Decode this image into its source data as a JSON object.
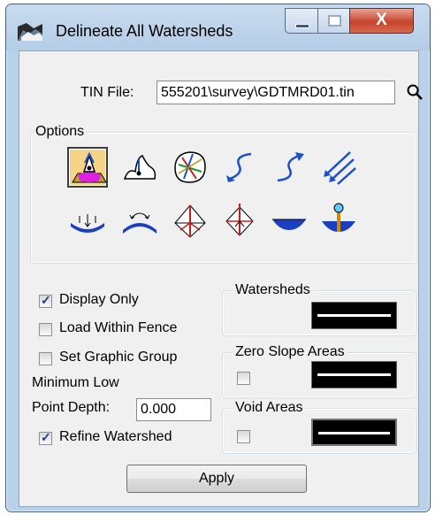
{
  "window": {
    "title": "Delineate All Watersheds",
    "close_glyph": "X"
  },
  "tin": {
    "label": "TIN File:",
    "value": "555201\\survey\\GDTMRD01.tin",
    "search_icon": "magnifier-icon"
  },
  "options": {
    "title": "Options",
    "icons": [
      {
        "name": "delineate-watershed-icon",
        "selected": true
      },
      {
        "name": "single-watershed-icon",
        "selected": false
      },
      {
        "name": "colored-watersheds-icon",
        "selected": false
      },
      {
        "name": "flow-path-icon",
        "selected": false
      },
      {
        "name": "reverse-flow-path-icon",
        "selected": false
      },
      {
        "name": "flow-arrows-icon",
        "selected": false
      },
      {
        "name": "low-point-icon",
        "selected": false
      },
      {
        "name": "high-point-icon",
        "selected": false
      },
      {
        "name": "ridge-lines-icon",
        "selected": false
      },
      {
        "name": "sump-lines-icon",
        "selected": false
      },
      {
        "name": "pond-icon",
        "selected": false
      },
      {
        "name": "pond-depth-icon",
        "selected": false
      }
    ]
  },
  "checks": {
    "display_only": {
      "label": "Display Only",
      "checked": true
    },
    "load_within_fence": {
      "label": "Load Within Fence",
      "checked": false
    },
    "set_graphic_group": {
      "label": "Set Graphic Group",
      "checked": false
    },
    "refine_watershed": {
      "label": "Refine Watershed",
      "checked": true
    }
  },
  "minimum_low": {
    "label_line1": "Minimum Low",
    "label_line2": "Point Depth:",
    "value": "0.000"
  },
  "symbology": {
    "watersheds": {
      "title": "Watersheds"
    },
    "zero_slope": {
      "title": "Zero Slope Areas",
      "checked": false
    },
    "void_areas": {
      "title": "Void Areas",
      "checked": false
    }
  },
  "apply_label": "Apply",
  "colors": {
    "title_bar": "#b9d1ea",
    "client_bg": "#f0f0f0",
    "selected_option": "#f5d487",
    "close_button": "#c7432c",
    "swatch": "#000000"
  }
}
